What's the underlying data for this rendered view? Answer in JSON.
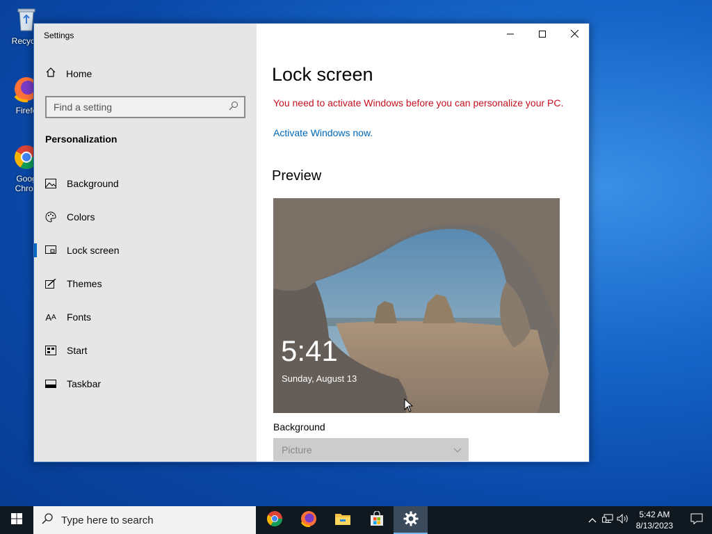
{
  "desktop": {
    "icons": [
      {
        "label": "Recycle"
      },
      {
        "label": "Firefo"
      },
      {
        "label": "Goog Chron"
      }
    ]
  },
  "window": {
    "title": "Settings",
    "controls": {
      "minimize": "minimize-icon",
      "maximize": "maximize-icon",
      "close": "close-icon"
    }
  },
  "sidebar": {
    "home_label": "Home",
    "search_placeholder": "Find a setting",
    "section_title": "Personalization",
    "items": [
      {
        "label": "Background",
        "icon": "picture-icon",
        "active": false
      },
      {
        "label": "Colors",
        "icon": "palette-icon",
        "active": false
      },
      {
        "label": "Lock screen",
        "icon": "lock-screen-icon",
        "active": true
      },
      {
        "label": "Themes",
        "icon": "themes-icon",
        "active": false
      },
      {
        "label": "Fonts",
        "icon": "fonts-icon",
        "active": false
      },
      {
        "label": "Start",
        "icon": "start-icon",
        "active": false
      },
      {
        "label": "Taskbar",
        "icon": "taskbar-icon",
        "active": false
      }
    ]
  },
  "content": {
    "title": "Lock screen",
    "warning": "You need to activate Windows before you can personalize your PC.",
    "activate_link": "Activate Windows now.",
    "preview_heading": "Preview",
    "preview_time": "5:41",
    "preview_date": "Sunday, August 13",
    "background_label": "Background",
    "background_value": "Picture"
  },
  "taskbar": {
    "search_placeholder": "Type here to search",
    "apps": [
      "chrome-icon",
      "firefox-icon",
      "file-explorer-icon",
      "store-icon",
      "settings-icon"
    ],
    "clock_time": "5:42 AM",
    "clock_date": "8/13/2023"
  },
  "colors": {
    "accent": "#0067c0",
    "warning": "#c50f1f",
    "link": "#0067b8"
  }
}
